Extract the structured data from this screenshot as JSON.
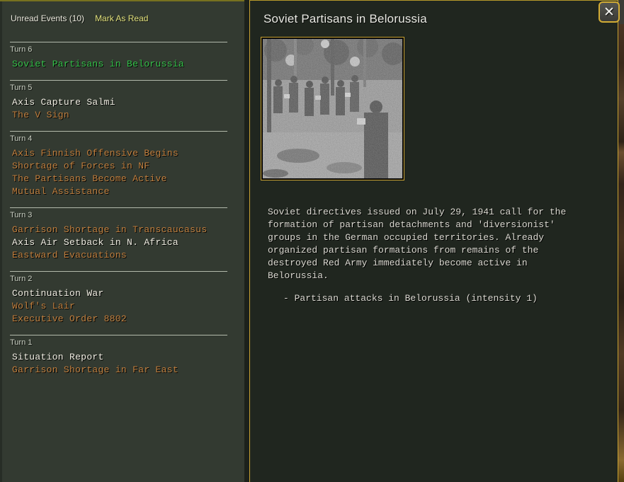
{
  "colors": {
    "accent_gold": "#c9a233",
    "selected_green": "#35c24a",
    "read_orange": "#c2803f",
    "unread_white": "#f2efe4",
    "left_panel_bg": "#333a31",
    "detail_panel_bg": "#20261f"
  },
  "left_panel": {
    "unread_events_label": "Unread Events (10)",
    "mark_as_read_label": "Mark As Read",
    "turns": [
      {
        "label": "Turn 6",
        "events": [
          {
            "title": "Soviet Partisans in Belorussia",
            "state": "selected"
          }
        ]
      },
      {
        "label": "Turn 5",
        "events": [
          {
            "title": "Axis Capture Salmi",
            "state": "unread"
          },
          {
            "title": "The V Sign",
            "state": "read"
          }
        ]
      },
      {
        "label": "Turn 4",
        "events": [
          {
            "title": "Axis Finnish Offensive Begins",
            "state": "read"
          },
          {
            "title": "Shortage of Forces in NF",
            "state": "read"
          },
          {
            "title": "The Partisans Become Active",
            "state": "read"
          },
          {
            "title": "Mutual Assistance",
            "state": "read"
          }
        ]
      },
      {
        "label": "Turn 3",
        "events": [
          {
            "title": "Garrison Shortage in Transcaucasus",
            "state": "read"
          },
          {
            "title": "Axis Air Setback in N. Africa",
            "state": "unread"
          },
          {
            "title": "Eastward Evacuations",
            "state": "read"
          }
        ]
      },
      {
        "label": "Turn 2",
        "events": [
          {
            "title": "Continuation War",
            "state": "unread"
          },
          {
            "title": "Wolf's Lair",
            "state": "read"
          },
          {
            "title": "Executive Order 8802",
            "state": "read"
          }
        ]
      },
      {
        "label": "Turn 1",
        "events": [
          {
            "title": "Situation Report",
            "state": "unread"
          },
          {
            "title": "Garrison Shortage in Far East",
            "state": "read"
          }
        ]
      }
    ]
  },
  "detail_panel": {
    "title": "Soviet Partisans in Belorussia",
    "close_glyph": "✕",
    "description": "Soviet directives issued on July 29, 1941 call for the\nformation of partisan detachments and 'diversionist'\ngroups in the German occupied territories. Already\norganized partisan formations from remains of the\ndestroyed Red Army immediately become active in\nBelorussia.",
    "effect": "- Partisan attacks in Belorussia (intensity 1)"
  }
}
